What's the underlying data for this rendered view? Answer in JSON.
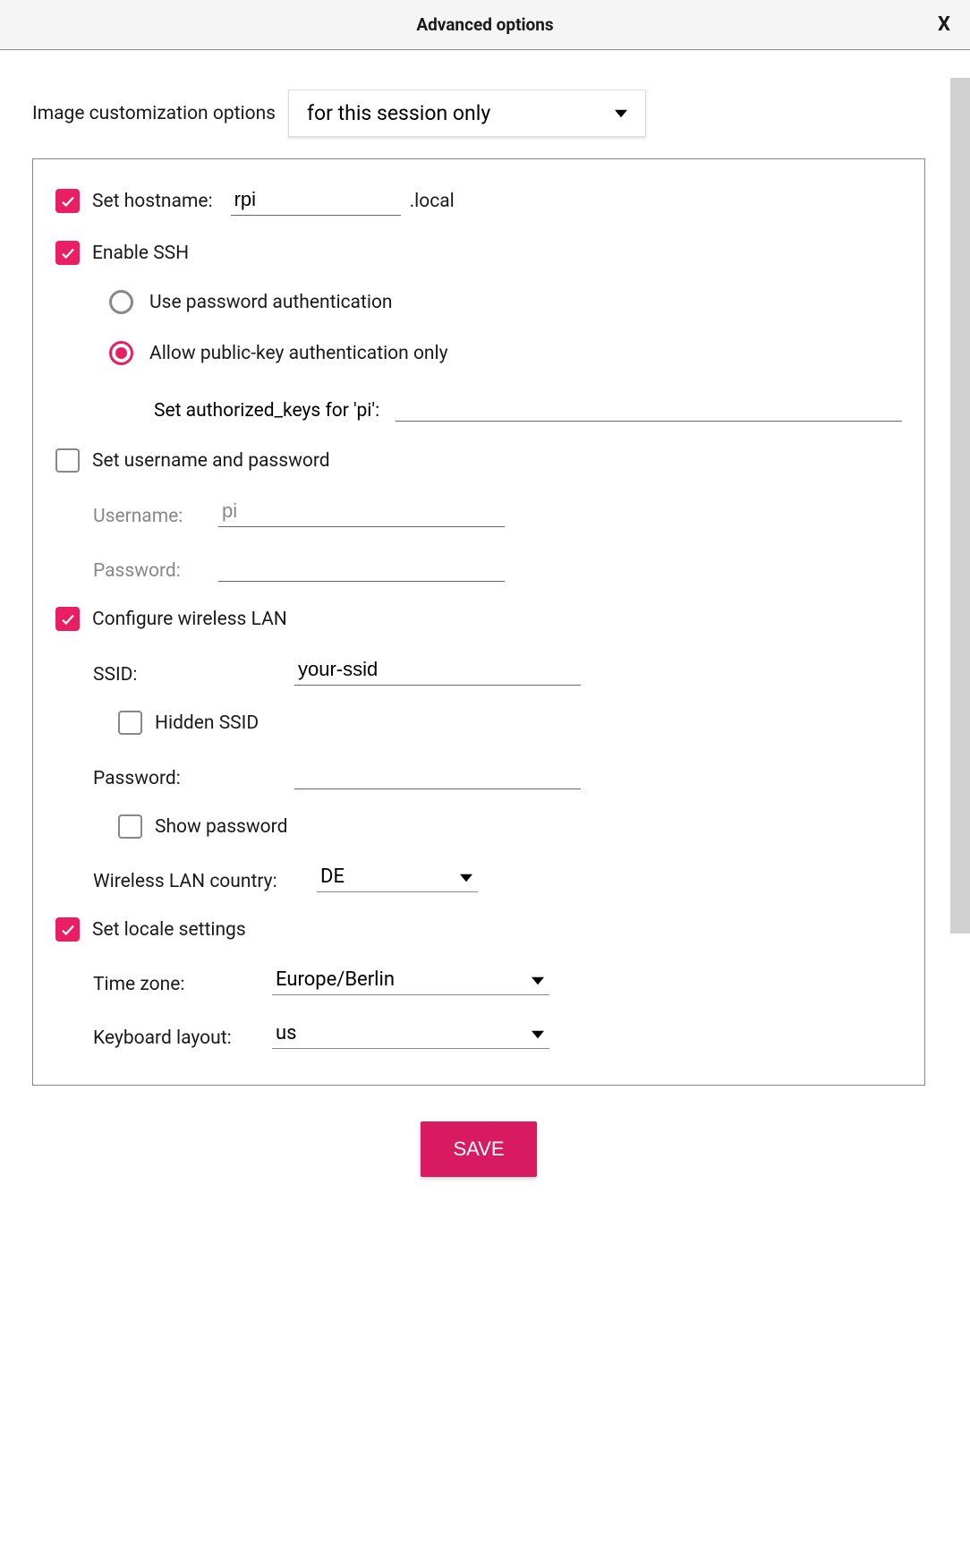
{
  "header": {
    "title": "Advanced options",
    "close": "X"
  },
  "customization_label": "Image customization options",
  "session_scope": {
    "selected": "for this session only"
  },
  "hostname": {
    "label": "Set hostname:",
    "value": "rpi",
    "suffix": ".local",
    "checked": true
  },
  "ssh": {
    "label": "Enable SSH",
    "checked": true,
    "mode": "pubkey",
    "option_password": "Use password authentication",
    "option_pubkey": "Allow public-key authentication only",
    "authkeys_label": "Set authorized_keys for 'pi':",
    "authkeys_value": ""
  },
  "userpass": {
    "label": "Set username and password",
    "checked": false,
    "username_label": "Username:",
    "username_value": "pi",
    "password_label": "Password:",
    "password_value": ""
  },
  "wlan": {
    "label": "Configure wireless LAN",
    "checked": true,
    "ssid_label": "SSID:",
    "ssid_value": "your-ssid",
    "hidden_label": "Hidden SSID",
    "hidden_checked": false,
    "password_label": "Password:",
    "password_value": "",
    "show_password_label": "Show password",
    "show_password_checked": false,
    "country_label": "Wireless LAN country:",
    "country_value": "DE"
  },
  "locale": {
    "label": "Set locale settings",
    "checked": true,
    "tz_label": "Time zone:",
    "tz_value": "Europe/Berlin",
    "kb_label": "Keyboard layout:",
    "kb_value": "us"
  },
  "save_button": "SAVE"
}
